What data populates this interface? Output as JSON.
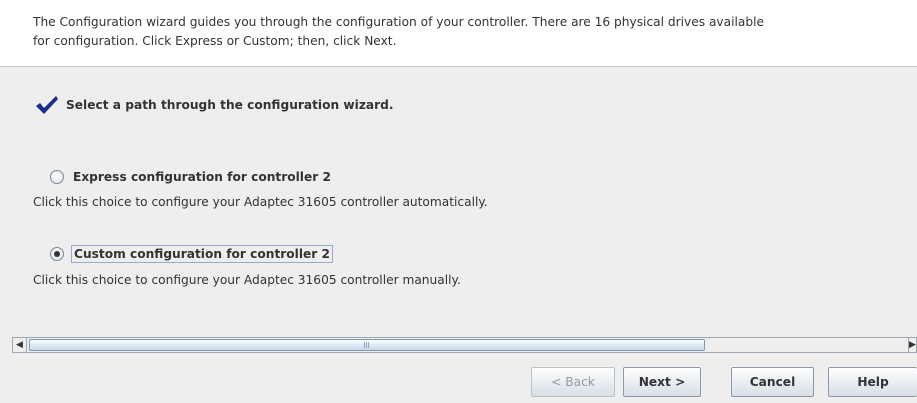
{
  "intro": {
    "line1": "The Configuration wizard guides you through the configuration of your controller. There are 16 physical drives available",
    "line2": "for configuration. Click Express or Custom; then, click Next."
  },
  "step": {
    "icon": "checkmark-icon",
    "title": "Select a path through the configuration wizard."
  },
  "options": {
    "express": {
      "label": "Express configuration for controller 2",
      "description": "Click this choice to configure your Adaptec 31605 controller automatically.",
      "selected": false
    },
    "custom": {
      "label": "Custom configuration for controller 2",
      "description": "Click this choice to configure your Adaptec 31605 controller manually.",
      "selected": true
    }
  },
  "buttons": {
    "back": "< Back",
    "next": "Next >",
    "cancel": "Cancel",
    "help": "Help"
  },
  "colors": {
    "accent": "#1a2d8c",
    "text": "#333333",
    "panel": "#eeeeee"
  }
}
